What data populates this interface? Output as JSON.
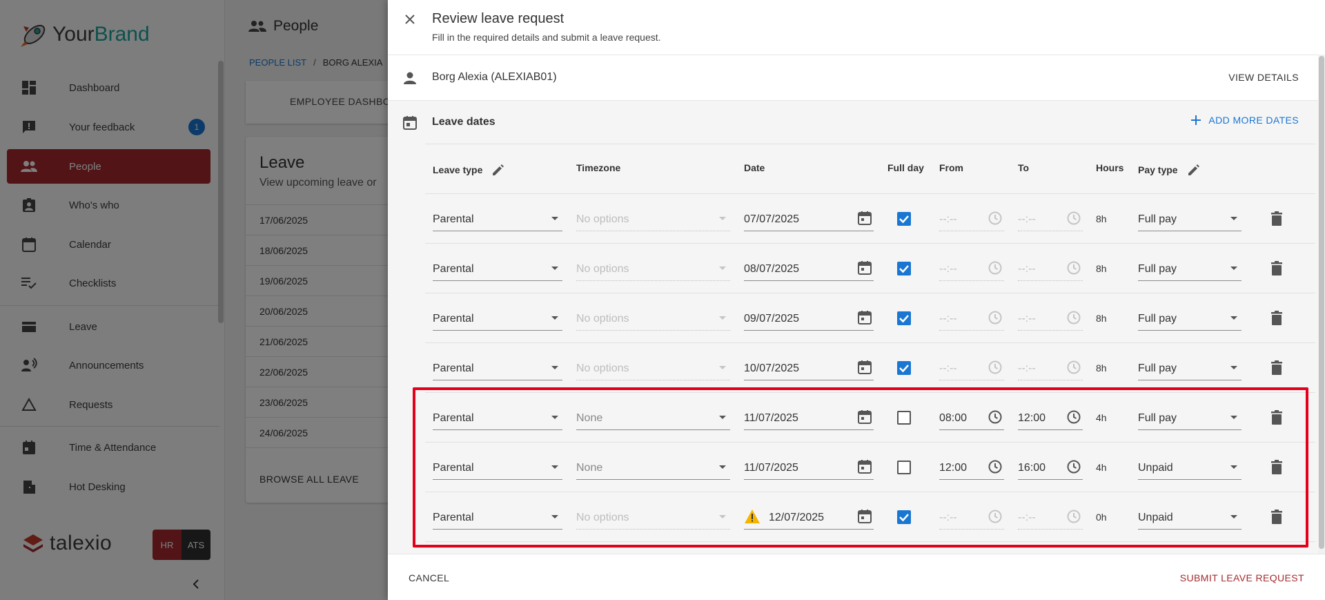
{
  "sidebar": {
    "brand_your": "Your",
    "brand_brand": "Brand",
    "items": [
      {
        "label": "Dashboard",
        "icon": "dashboard-icon"
      },
      {
        "label": "Your feedback",
        "icon": "feedback-icon",
        "badge": "1"
      },
      {
        "label": "People",
        "icon": "people-icon",
        "active": true
      },
      {
        "label": "Who's who",
        "icon": "badge-icon"
      },
      {
        "label": "Calendar",
        "icon": "calendar-icon"
      },
      {
        "label": "Checklists",
        "icon": "checklist-icon"
      },
      {
        "label": "Leave",
        "icon": "leave-icon"
      },
      {
        "label": "Announcements",
        "icon": "announcement-icon"
      },
      {
        "label": "Requests",
        "icon": "requests-icon"
      },
      {
        "label": "Time & Attendance",
        "icon": "time-attendance-icon"
      },
      {
        "label": "Hot Desking",
        "icon": "hot-desking-icon"
      }
    ],
    "footer_logo": "talexio",
    "hr_label": "HR",
    "ats_label": "ATS"
  },
  "main": {
    "title": "People",
    "breadcrumb_root": "PEOPLE LIST",
    "breadcrumb_sep": "/",
    "breadcrumb_current": "BORG ALEXIA",
    "tab_label": "EMPLOYEE DASHBO",
    "leave_title": "Leave",
    "leave_subtitle": "View upcoming leave or",
    "leave_dates": [
      "17/06/2025",
      "18/06/2025",
      "19/06/2025",
      "20/06/2025",
      "21/06/2025",
      "22/06/2025",
      "23/06/2025",
      "24/06/2025"
    ],
    "browse_label": "BROWSE ALL LEAVE"
  },
  "dialog": {
    "title": "Review leave request",
    "subtitle": "Fill in the required details and submit a leave request.",
    "employee_name": "Borg Alexia (ALEXIAB01)",
    "view_details_label": "VIEW DETAILS",
    "dates_title": "Leave dates",
    "add_dates_label": "ADD MORE DATES",
    "columns": {
      "leave_type": "Leave type",
      "timezone": "Timezone",
      "date": "Date",
      "full_day": "Full day",
      "from": "From",
      "to": "To",
      "hours": "Hours",
      "pay_type": "Pay type"
    },
    "rows": [
      {
        "leave_type": "Parental",
        "timezone": "No options",
        "timezone_disabled": true,
        "date": "07/07/2025",
        "full_day": true,
        "from": "--:--",
        "to": "--:--",
        "hours": "8h",
        "pay_type": "Full pay",
        "warning": false
      },
      {
        "leave_type": "Parental",
        "timezone": "No options",
        "timezone_disabled": true,
        "date": "08/07/2025",
        "full_day": true,
        "from": "--:--",
        "to": "--:--",
        "hours": "8h",
        "pay_type": "Full pay",
        "warning": false
      },
      {
        "leave_type": "Parental",
        "timezone": "No options",
        "timezone_disabled": true,
        "date": "09/07/2025",
        "full_day": true,
        "from": "--:--",
        "to": "--:--",
        "hours": "8h",
        "pay_type": "Full pay",
        "warning": false
      },
      {
        "leave_type": "Parental",
        "timezone": "No options",
        "timezone_disabled": true,
        "date": "10/07/2025",
        "full_day": true,
        "from": "--:--",
        "to": "--:--",
        "hours": "8h",
        "pay_type": "Full pay",
        "warning": false
      },
      {
        "leave_type": "Parental",
        "timezone": "None",
        "timezone_disabled": false,
        "date": "11/07/2025",
        "full_day": false,
        "from": "08:00",
        "to": "12:00",
        "hours": "4h",
        "pay_type": "Full pay",
        "warning": false
      },
      {
        "leave_type": "Parental",
        "timezone": "None",
        "timezone_disabled": false,
        "date": "11/07/2025",
        "full_day": false,
        "from": "12:00",
        "to": "16:00",
        "hours": "4h",
        "pay_type": "Unpaid",
        "warning": false
      },
      {
        "leave_type": "Parental",
        "timezone": "No options",
        "timezone_disabled": true,
        "date": "12/07/2025",
        "full_day": true,
        "from": "--:--",
        "to": "--:--",
        "hours": "0h",
        "pay_type": "Unpaid",
        "warning": true
      }
    ],
    "cancel_label": "CANCEL",
    "submit_label": "SUBMIT LEAVE REQUEST"
  },
  "colors": {
    "accent": "#1976d2",
    "brand_red": "#a4292e",
    "highlight": "#e4001b",
    "warning": "#f5b400"
  }
}
